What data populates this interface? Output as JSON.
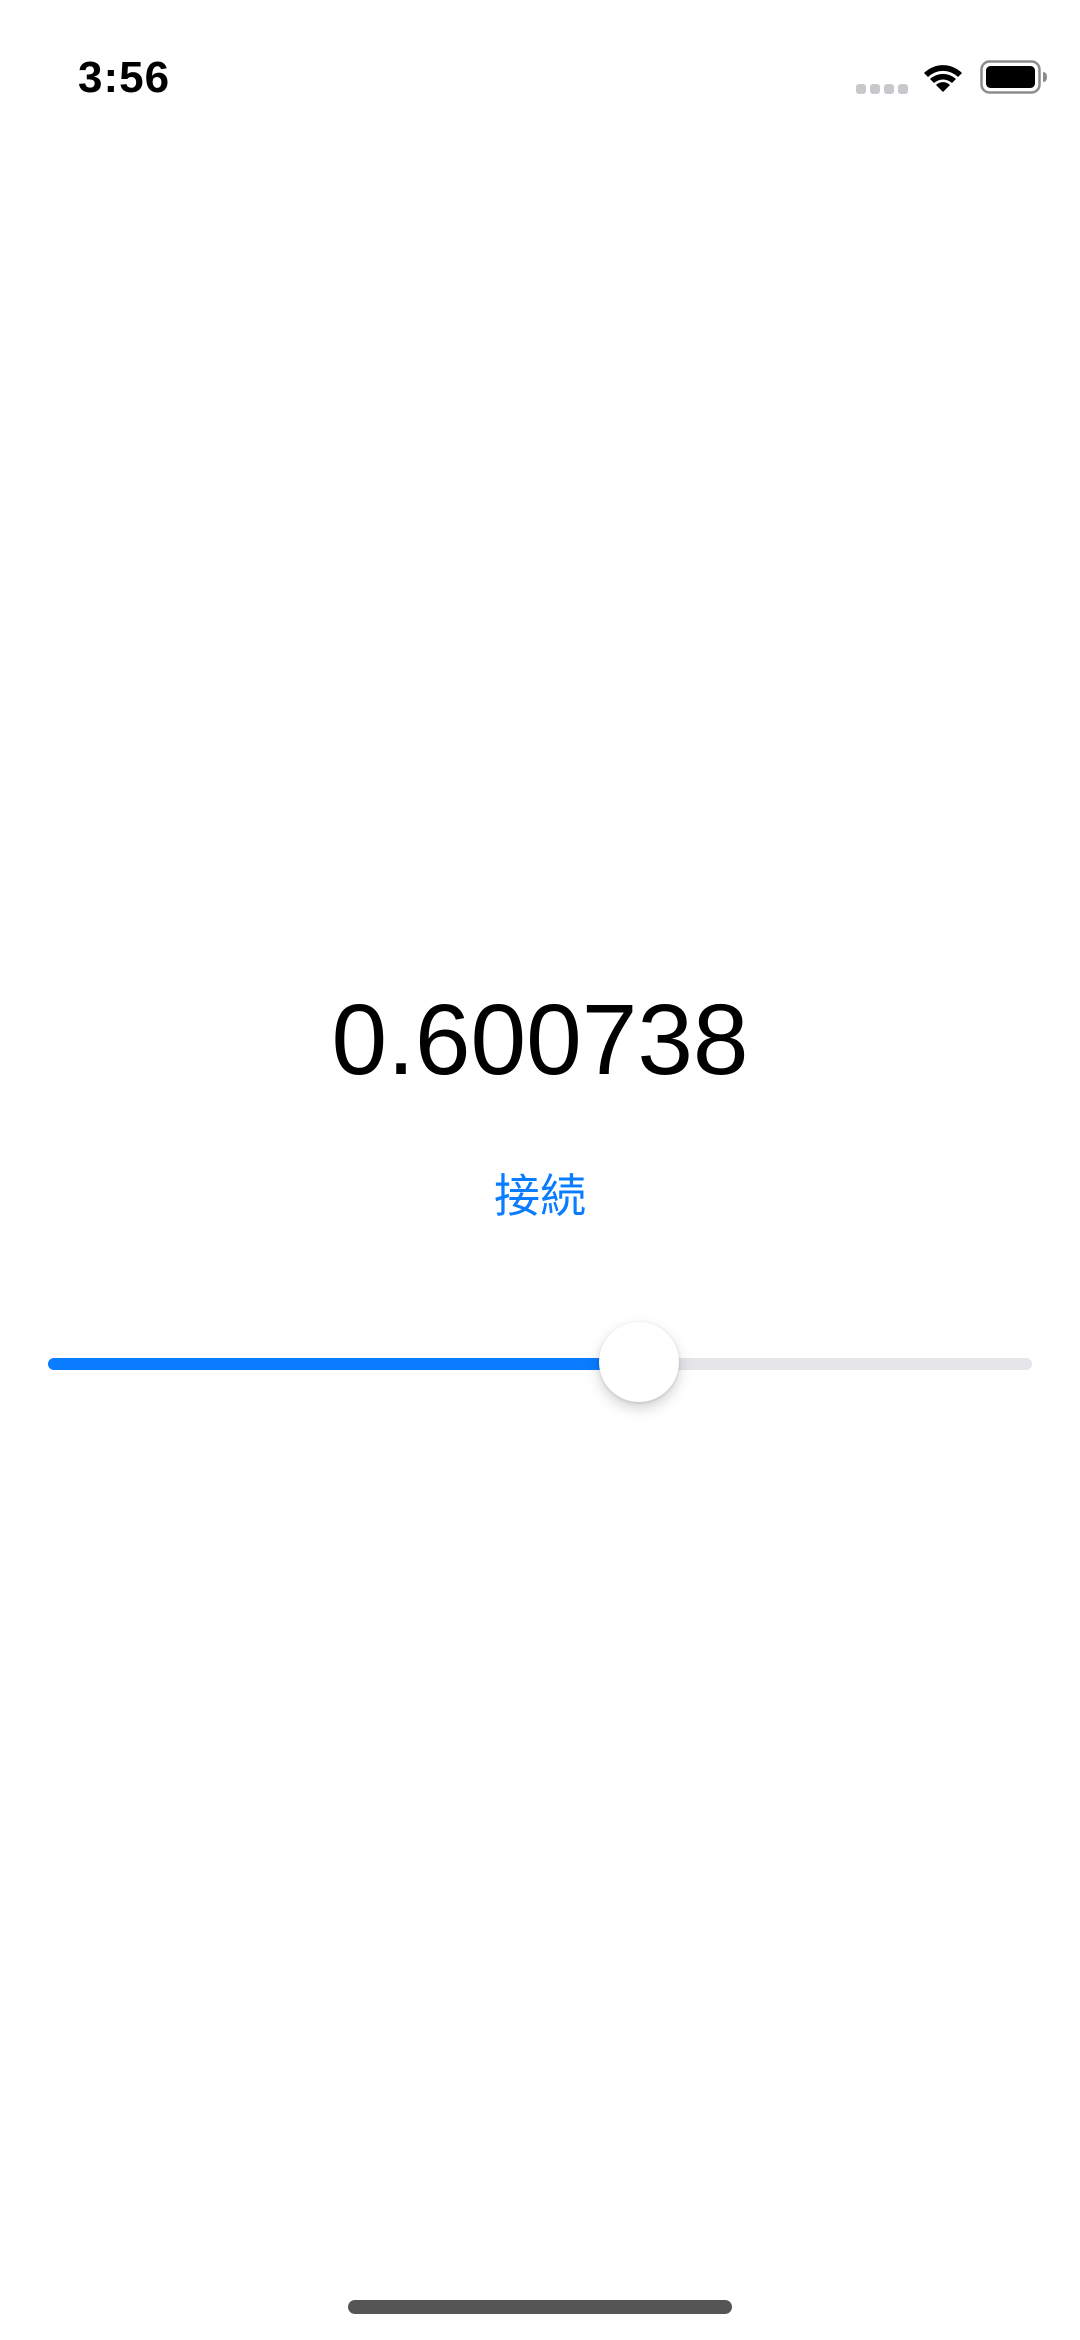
{
  "status_bar": {
    "time": "3:56",
    "icons": [
      "cellular-signal-icon",
      "wifi-icon",
      "battery-icon"
    ]
  },
  "main": {
    "value_text": "0.600738",
    "connect_button_label": "接続",
    "slider": {
      "value": 0.600738,
      "min": 0,
      "max": 1
    }
  },
  "colors": {
    "accent": "#0a7cff",
    "track": "#e5e5ea",
    "text": "#000000",
    "background": "#ffffff"
  }
}
